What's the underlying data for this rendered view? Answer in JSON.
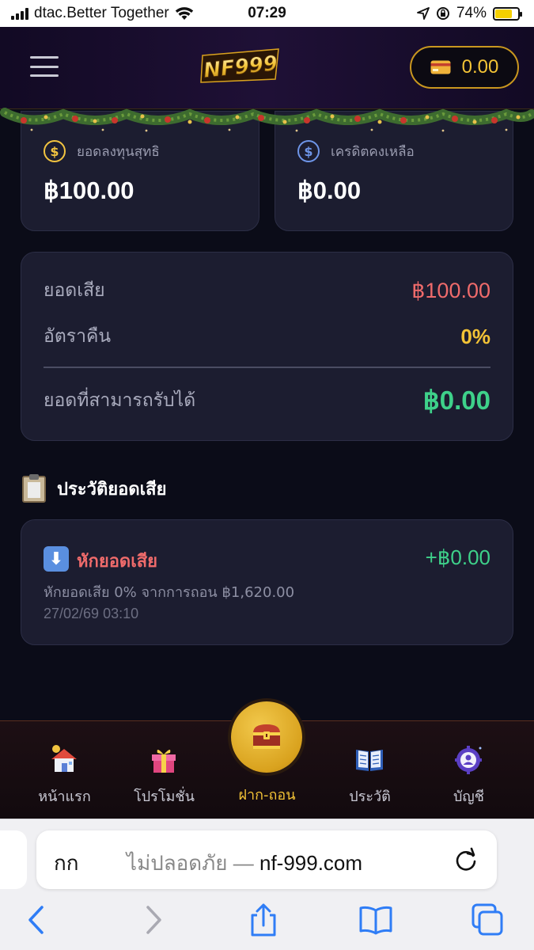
{
  "status_bar": {
    "carrier": "dtac.Better Together",
    "time": "07:29",
    "battery": "74%",
    "battery_level": 0.74
  },
  "header": {
    "logo_text": "NF999",
    "wallet_amount": "0.00",
    "wallet_icon": "credit-card-icon",
    "menu_icon": "hamburger-menu-icon"
  },
  "stats": {
    "net_deposit_label": "ยอดลงทุนสุทธิ",
    "net_deposit_value": "฿100.00",
    "credit_label": "เครดิตคงเหลือ",
    "credit_value": "฿0.00"
  },
  "summary": {
    "loss_label": "ยอดเสีย",
    "loss_value": "฿100.00",
    "rate_label": "อัตราคืน",
    "rate_value": "0%",
    "receivable_label": "ยอดที่สามารถรับได้",
    "receivable_value": "฿0.00"
  },
  "history": {
    "section_title": "ประวัติยอดเสีย",
    "items": [
      {
        "title": "หักยอดเสีย",
        "amount": "+฿0.00",
        "description": "หักยอดเสีย 0% จากการถอน ฿1,620.00",
        "date": "27/02/69 03:10",
        "icon": "down-arrow-icon"
      }
    ]
  },
  "bottom_nav": {
    "items": [
      {
        "label": "หน้าแรก",
        "icon": "home-icon"
      },
      {
        "label": "โปรโมชั่น",
        "icon": "gift-icon"
      },
      {
        "label": "ฝาก-ถอน",
        "icon": "treasure-chest-icon",
        "active": true
      },
      {
        "label": "ประวัติ",
        "icon": "book-icon"
      },
      {
        "label": "บัญชี",
        "icon": "account-gear-icon"
      }
    ]
  },
  "safari": {
    "aa_label": "กก",
    "insecure_label": "ไม่ปลอดภัย —",
    "domain": "nf-999.com"
  },
  "colors": {
    "accent_gold": "#f3c336",
    "loss_red": "#ef6b6b",
    "gain_green": "#3ed18a",
    "card_bg": "#1c1d30"
  }
}
